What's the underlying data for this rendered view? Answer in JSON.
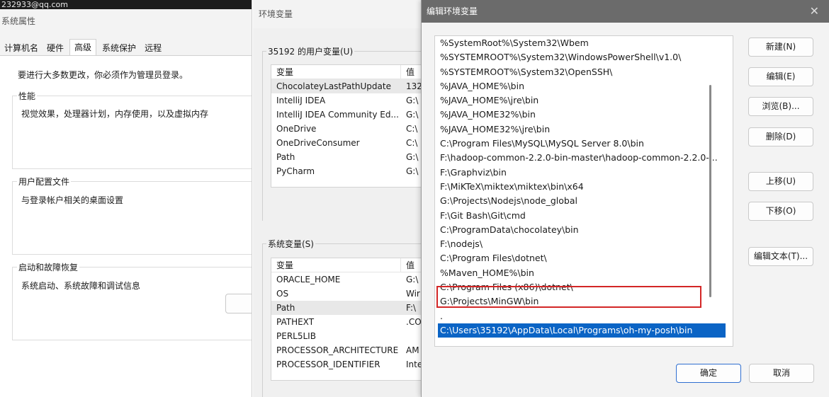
{
  "sys": {
    "strip": "232933@qq.com",
    "title": "系统属性",
    "tabs": [
      "计算机名",
      "硬件",
      "高级",
      "系统保护",
      "远程"
    ],
    "warn": "要进行大多数更改，你必须作为管理员登录。",
    "perf_label": "性能",
    "perf_desc": "视觉效果，处理器计划，内存使用，以及虚拟内存",
    "profile_label": "用户配置文件",
    "profile_desc": "与登录帐户相关的桌面设置",
    "startup_label": "启动和故障恢复",
    "startup_desc": "系统启动、系统故障和调试信息"
  },
  "env": {
    "title": "环境变量",
    "user_group": "35192 的用户变量(U)",
    "col_var": "变量",
    "col_val": "值",
    "user_vars": [
      {
        "name": "ChocolateyLastPathUpdate",
        "value": "132"
      },
      {
        "name": "IntelliJ IDEA",
        "value": "G:\\"
      },
      {
        "name": "IntelliJ IDEA Community Ed...",
        "value": "G:\\"
      },
      {
        "name": "OneDrive",
        "value": "C:\\"
      },
      {
        "name": "OneDriveConsumer",
        "value": "C:\\"
      },
      {
        "name": "Path",
        "value": "G:\\"
      },
      {
        "name": "PyCharm",
        "value": "G:\\"
      }
    ],
    "sys_group": "系统变量(S)",
    "sys_vars": [
      {
        "name": "ORACLE_HOME",
        "value": "G:\\"
      },
      {
        "name": "OS",
        "value": "Wir"
      },
      {
        "name": "Path",
        "value": "F:\\"
      },
      {
        "name": "PATHEXT",
        "value": ".CO"
      },
      {
        "name": "PERL5LIB",
        "value": ""
      },
      {
        "name": "PROCESSOR_ARCHITECTURE",
        "value": "AM"
      },
      {
        "name": "PROCESSOR_IDENTIFIER",
        "value": "Inte"
      }
    ]
  },
  "edit": {
    "title": "编辑环境变量",
    "close": "✕",
    "items": [
      "%SystemRoot%\\System32\\Wbem",
      "%SYSTEMROOT%\\System32\\WindowsPowerShell\\v1.0\\",
      "%SYSTEMROOT%\\System32\\OpenSSH\\",
      "%JAVA_HOME%\\bin",
      "%JAVA_HOME%\\jre\\bin",
      "%JAVA_HOME32%\\bin",
      "%JAVA_HOME32%\\jre\\bin",
      "C:\\Program Files\\MySQL\\MySQL Server 8.0\\bin",
      "F:\\hadoop-common-2.2.0-bin-master\\hadoop-common-2.2.0-...",
      "F:\\Graphviz\\bin",
      "F:\\MiKTeX\\miktex\\miktex\\bin\\x64",
      "G:\\Projects\\Nodejs\\node_global",
      "F:\\Git Bash\\Git\\cmd",
      "C:\\ProgramData\\chocolatey\\bin",
      "F:\\nodejs\\",
      "C:\\Program Files\\dotnet\\",
      "%Maven_HOME%\\bin",
      "C:\\Program Files (x86)\\dotnet\\",
      "G:\\Projects\\MinGW\\bin",
      ".",
      "C:\\Users\\35192\\AppData\\Local\\Programs\\oh-my-posh\\bin"
    ],
    "selected_index": 20,
    "buttons": {
      "new": "新建(N)",
      "edit": "编辑(E)",
      "browse": "浏览(B)...",
      "delete": "删除(D)",
      "up": "上移(U)",
      "down": "下移(O)",
      "edit_text": "编辑文本(T)...",
      "ok": "确定",
      "cancel": "取消"
    }
  }
}
